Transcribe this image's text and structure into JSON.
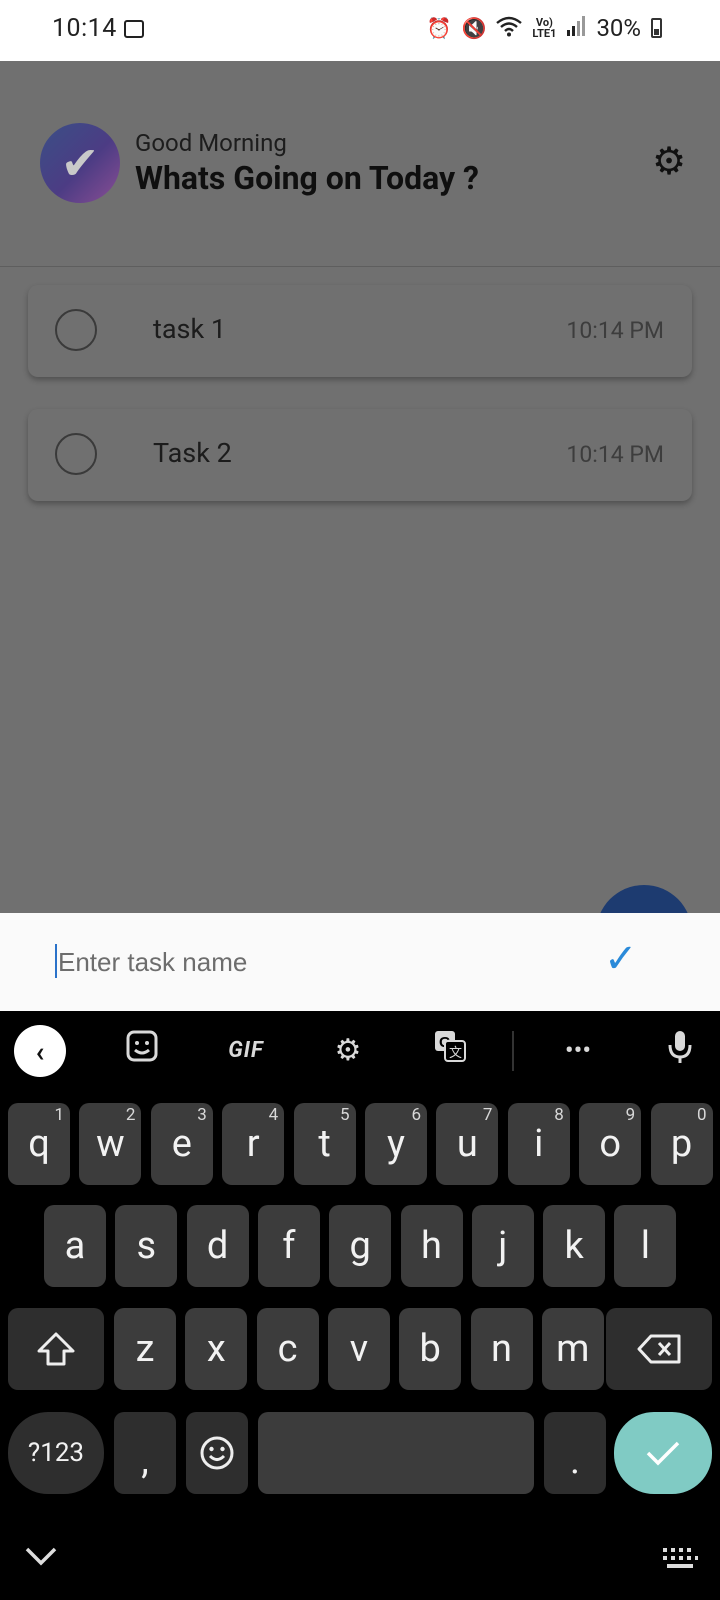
{
  "status_bar": {
    "time": "10:14",
    "battery": "30%",
    "icons": [
      "gallery-icon",
      "alarm-icon",
      "mute-icon",
      "wifi-icon",
      "volte-icon",
      "signal-icon",
      "battery-icon"
    ]
  },
  "header": {
    "greeting": "Good Morning",
    "title": "Whats Going on Today ?"
  },
  "tasks": [
    {
      "name": "task 1",
      "time": "10:14 PM"
    },
    {
      "name": "Task 2",
      "time": "10:14 PM"
    }
  ],
  "input": {
    "placeholder": "Enter task name",
    "value": ""
  },
  "keyboard": {
    "toolbar": {
      "gif": "GIF"
    },
    "row1": [
      {
        "k": "q",
        "h": "1"
      },
      {
        "k": "w",
        "h": "2"
      },
      {
        "k": "e",
        "h": "3"
      },
      {
        "k": "r",
        "h": "4"
      },
      {
        "k": "t",
        "h": "5"
      },
      {
        "k": "y",
        "h": "6"
      },
      {
        "k": "u",
        "h": "7"
      },
      {
        "k": "i",
        "h": "8"
      },
      {
        "k": "o",
        "h": "9"
      },
      {
        "k": "p",
        "h": "0"
      }
    ],
    "row2": [
      "a",
      "s",
      "d",
      "f",
      "g",
      "h",
      "j",
      "k",
      "l"
    ],
    "row3": [
      "z",
      "x",
      "c",
      "v",
      "b",
      "n",
      "m"
    ],
    "symbols": "?123",
    "comma": ",",
    "period": "."
  },
  "colors": {
    "overlay_bg": "#707070",
    "accent_check": "#2a8ad9",
    "enter_key": "#80cbc4",
    "fab": "#1d3b70"
  }
}
